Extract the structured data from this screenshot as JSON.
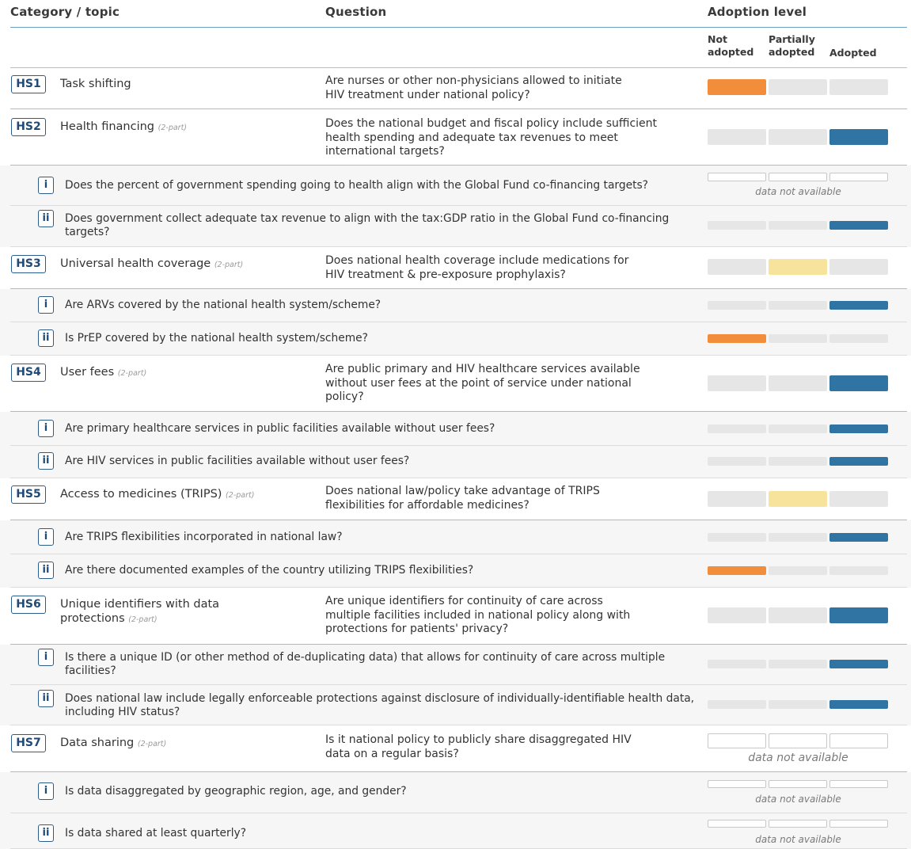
{
  "header": {
    "col_category": "Category / topic",
    "col_question": "Question",
    "col_adoption": "Adoption level",
    "level_not": "Not adopted",
    "level_partial": "Partially adopted",
    "level_adopted": "Adopted"
  },
  "colors": {
    "not_adopted": "#f28e3b",
    "partially_adopted": "#f7e39c",
    "adopted": "#2f74a2",
    "inactive": "#e6e6e6",
    "badge_border": "#2c5d8a"
  },
  "rows": [
    {
      "kind": "main",
      "code": "HS1",
      "topic": "Task shifting",
      "parts": "",
      "question": "Are nurses or other non-physicians allowed to initiate HIV treatment under national policy?",
      "level": "not",
      "na": ""
    },
    {
      "kind": "main",
      "code": "HS2",
      "topic": "Health financing",
      "parts": "(2-part)",
      "question": "Does the national budget and fiscal policy include sufficient health spending and adequate tax revenues to meet international targets?",
      "level": "adopted",
      "na": ""
    },
    {
      "kind": "sub",
      "code": "i",
      "question": "Does the percent of government spending going to health align with the Global Fund co-financing targets?",
      "level": "none",
      "na": "data not available"
    },
    {
      "kind": "sub",
      "code": "ii",
      "question": "Does government collect adequate tax revenue to align with the tax:GDP ratio in the Global Fund co-financing targets?",
      "level": "adopted",
      "na": ""
    },
    {
      "kind": "main",
      "code": "HS3",
      "topic": "Universal health coverage",
      "parts": "(2-part)",
      "question": "Does national health coverage include medications for HIV treatment & pre-exposure prophylaxis?",
      "level": "partial",
      "na": ""
    },
    {
      "kind": "sub",
      "code": "i",
      "question": "Are ARVs covered by the national health system/scheme?",
      "level": "adopted",
      "na": ""
    },
    {
      "kind": "sub",
      "code": "ii",
      "question": "Is PrEP covered by the national health system/scheme?",
      "level": "not",
      "na": ""
    },
    {
      "kind": "main",
      "code": "HS4",
      "topic": "User fees",
      "parts": "(2-part)",
      "question": "Are public primary and HIV healthcare services available without user fees at the point of service under national policy?",
      "level": "adopted",
      "na": ""
    },
    {
      "kind": "sub",
      "code": "i",
      "question": "Are primary healthcare services in public facilities available without user fees?",
      "level": "adopted",
      "na": ""
    },
    {
      "kind": "sub",
      "code": "ii",
      "question": "Are HIV services in public facilities available without user fees?",
      "level": "adopted",
      "na": ""
    },
    {
      "kind": "main",
      "code": "HS5",
      "topic": "Access to medicines (TRIPS)",
      "parts": "(2-part)",
      "question": "Does national law/policy take advantage of TRIPS flexibilities for affordable medicines?",
      "level": "partial",
      "na": ""
    },
    {
      "kind": "sub",
      "code": "i",
      "question": "Are TRIPS flexibilities incorporated in national law?",
      "level": "adopted",
      "na": ""
    },
    {
      "kind": "sub",
      "code": "ii",
      "question": "Are there documented examples of the country utilizing TRIPS flexibilities?",
      "level": "not",
      "na": ""
    },
    {
      "kind": "main",
      "code": "HS6",
      "topic": "Unique identifiers with data protections",
      "parts": "(2-part)",
      "question": "Are unique identifiers for continuity of care across multiple facilities included in national policy along with protections for patients' privacy?",
      "level": "adopted",
      "na": ""
    },
    {
      "kind": "sub",
      "code": "i",
      "question": "Is there a unique ID (or other method of de-duplicating data) that allows for continuity of care across multiple facilities?",
      "level": "adopted",
      "na": ""
    },
    {
      "kind": "sub",
      "code": "ii",
      "question": "Does national law include legally enforceable protections against disclosure of individually-identifiable health data, including HIV status?",
      "level": "adopted",
      "na": ""
    },
    {
      "kind": "main",
      "code": "HS7",
      "topic": "Data sharing",
      "parts": "(2-part)",
      "question": "Is it national policy to publicly share disaggregated HIV data on a regular basis?",
      "level": "none",
      "na": "data not available"
    },
    {
      "kind": "sub",
      "code": "i",
      "question": "Is data disaggregated by geographic region, age, and gender?",
      "level": "none",
      "na": "data not available"
    },
    {
      "kind": "sub",
      "code": "ii",
      "question": "Is data shared at least quarterly?",
      "level": "none",
      "na": "data not available"
    }
  ]
}
